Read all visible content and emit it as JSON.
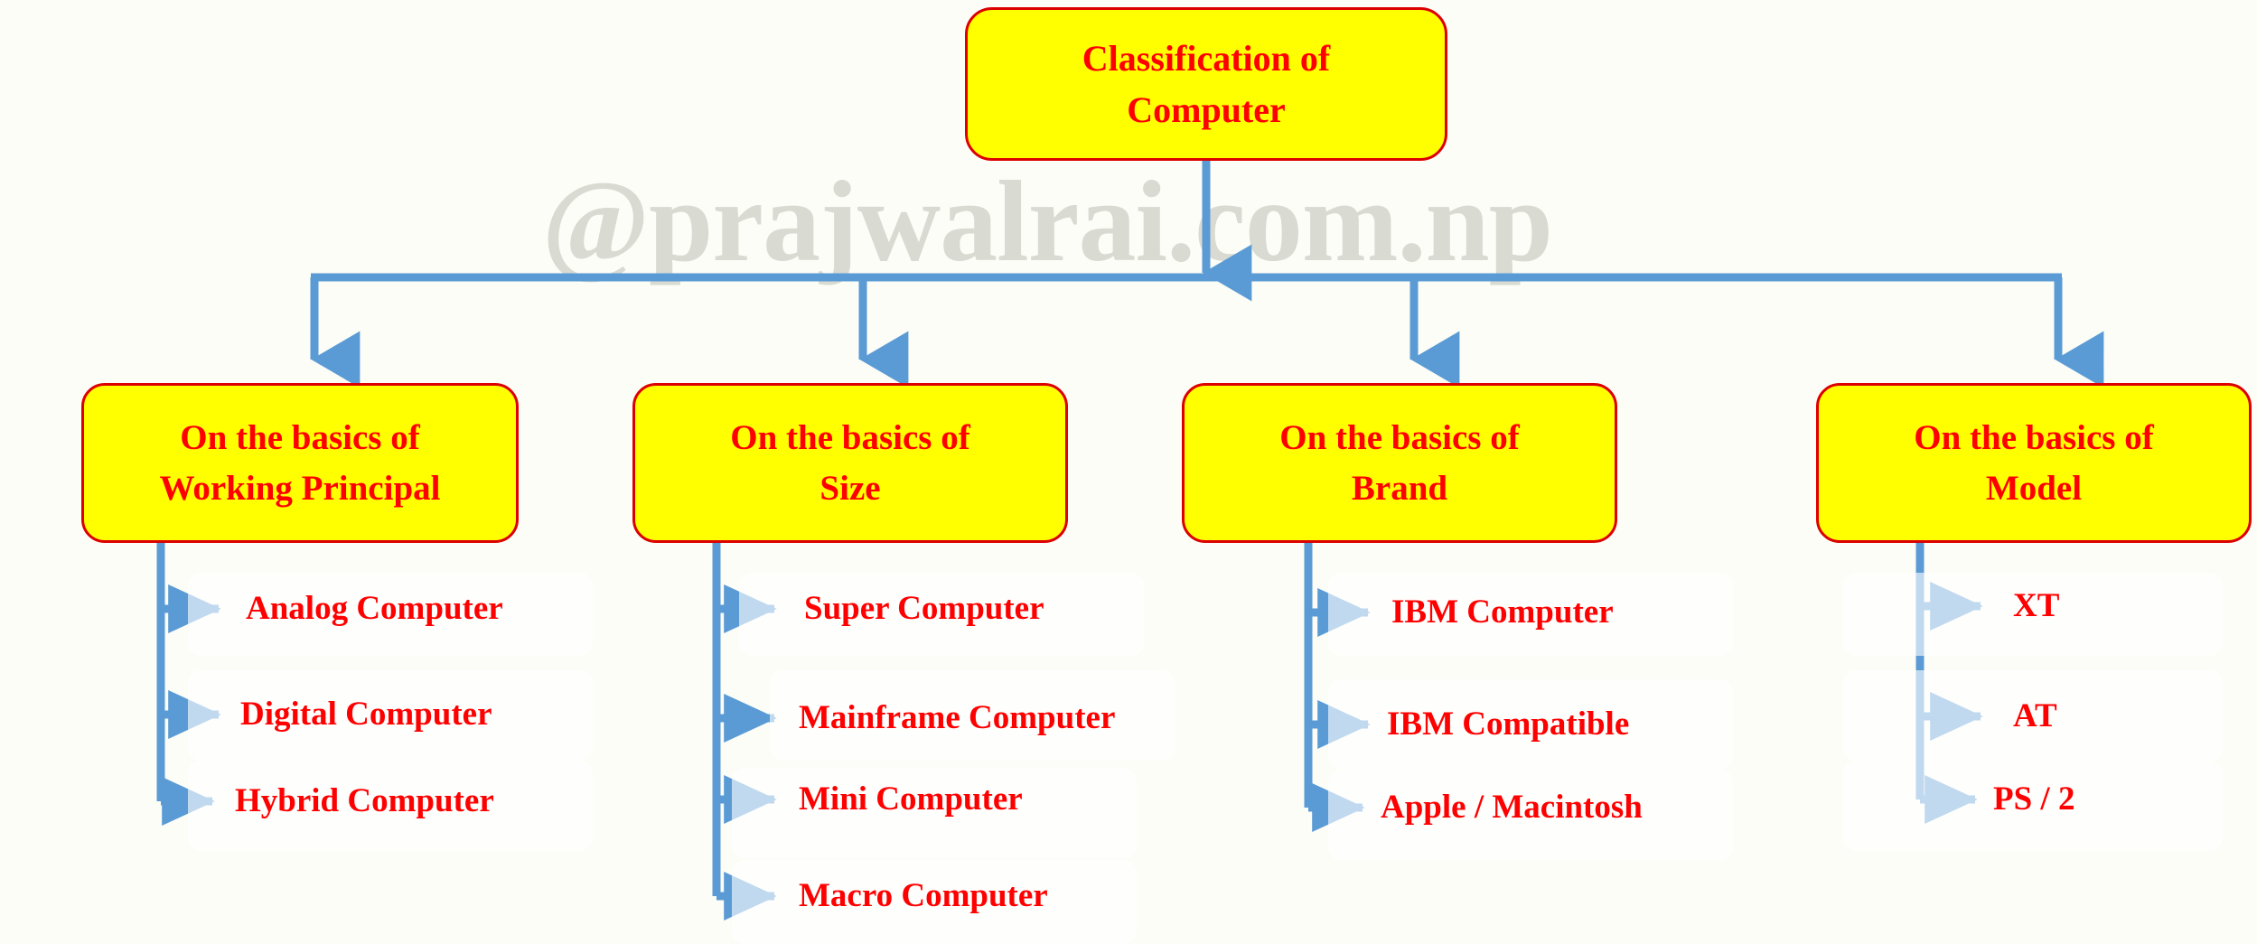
{
  "background_color": "#FCFDF7",
  "palette": {
    "node_fill": "#FFFF00",
    "node_border": "#DD0000",
    "node_text": "#FF0000",
    "connector": "#5B9BD5",
    "leaf_panel": "#FFFFFF",
    "watermark": "#D9DBD2"
  },
  "watermark": {
    "text": "@prajwalrai.com.np"
  },
  "diagram": {
    "type": "tree",
    "root": {
      "label_lines": [
        "Classification of",
        "Computer"
      ]
    },
    "branches": [
      {
        "label_lines": [
          "On the basics of",
          "Working Principal"
        ],
        "leaves": [
          "Analog Computer",
          "Digital Computer",
          "Hybrid Computer"
        ]
      },
      {
        "label_lines": [
          "On the basics of",
          "Size"
        ],
        "leaves": [
          "Super Computer",
          "Mainframe Computer",
          "Mini Computer",
          "Macro Computer"
        ]
      },
      {
        "label_lines": [
          "On the basics of",
          "Brand"
        ],
        "leaves": [
          "IBM Computer",
          "IBM Compatible",
          "Apple / Macintosh"
        ]
      },
      {
        "label_lines": [
          "On the basics of",
          "Model"
        ],
        "leaves": [
          "XT",
          "AT",
          "PS / 2"
        ]
      }
    ]
  }
}
